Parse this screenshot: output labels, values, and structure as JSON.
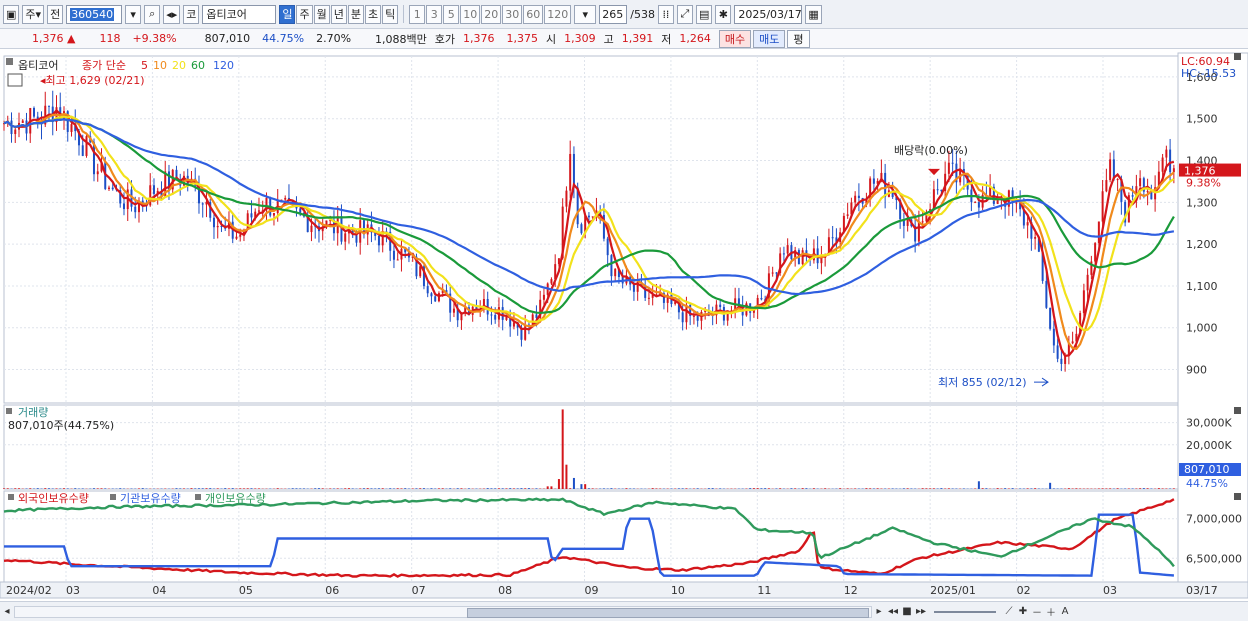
{
  "toolbar": {
    "chart_icon": "chart-icon",
    "stock_type": "주",
    "prev_label": "전",
    "code_value": "360540",
    "name_prefix": "코",
    "stock_name": "옵티코어",
    "periods": [
      "일",
      "주",
      "월",
      "년",
      "분",
      "초",
      "틱"
    ],
    "active_period": "일",
    "intervals": [
      "1",
      "3",
      "5",
      "10",
      "20",
      "30",
      "60",
      "120"
    ],
    "count_value": "265",
    "count_total": "/538",
    "date_value": "2025/03/17"
  },
  "quote": {
    "price": "1,376",
    "arrow": "▲",
    "change": "118",
    "change_pct": "+9.38%",
    "volume": "807,010",
    "vol_ratio": "44.75%",
    "turnover": "2.70%",
    "amount": "1,088백만",
    "ask_label": "호가",
    "ask": "1,376",
    "bid": "1,375",
    "open_label": "시",
    "open": "1,309",
    "high_label": "고",
    "high": "1,391",
    "low_label": "저",
    "low": "1,264",
    "buy_label": "매수",
    "sell_label": "매도",
    "eval_label": "평"
  },
  "colors": {
    "up": "#d4161b",
    "down": "#1c4fc6",
    "ma5": "#d4161b",
    "ma10": "#f08a1c",
    "ma20": "#f2e21b",
    "ma60": "#1a9a3a",
    "ma120": "#2f5fe0",
    "foreign": "#d4161b",
    "institution": "#2f5fe0",
    "individual": "#2f9a5c"
  },
  "chart_data": [
    {
      "type": "candlestick",
      "panel": "price",
      "legend": {
        "name": "옵티코어",
        "ma_label": "종가 단순",
        "ma_periods": [
          "5",
          "10",
          "20",
          "60",
          "120"
        ]
      },
      "x_ticks": [
        "2024/02",
        "03",
        "04",
        "05",
        "06",
        "07",
        "08",
        "09",
        "10",
        "11",
        "12",
        "2025/01",
        "02",
        "03",
        "03/17"
      ],
      "y_ticks": [
        900,
        1000,
        1100,
        1200,
        1300,
        1400,
        1500,
        1600
      ],
      "ylim": [
        820,
        1650
      ],
      "right_labels": {
        "lc": "LC:60.94",
        "hc": "HC:-15.53",
        "last_price": "1,376",
        "last_pct": "9.38%"
      },
      "annotations": {
        "high": "최고 1,629 (02/21)",
        "low": "최저 855 (02/12)",
        "ex_dividend": "배당락(0.00%)"
      },
      "close_path": [
        [
          "2024-02-01",
          1490
        ],
        [
          "2024-02-15",
          1500
        ],
        [
          "2024-02-21",
          1530
        ],
        [
          "2024-03-01",
          1460
        ],
        [
          "2024-03-08",
          1380
        ],
        [
          "2024-03-15",
          1320
        ],
        [
          "2024-03-22",
          1290
        ],
        [
          "2024-04-01",
          1340
        ],
        [
          "2024-04-10",
          1360
        ],
        [
          "2024-04-20",
          1300
        ],
        [
          "2024-04-25",
          1230
        ],
        [
          "2024-05-02",
          1220
        ],
        [
          "2024-05-10",
          1300
        ],
        [
          "2024-05-20",
          1280
        ],
        [
          "2024-06-01",
          1250
        ],
        [
          "2024-06-15",
          1230
        ],
        [
          "2024-06-25",
          1220
        ],
        [
          "2024-07-05",
          1170
        ],
        [
          "2024-07-15",
          1100
        ],
        [
          "2024-07-25",
          1040
        ],
        [
          "2024-08-01",
          1060
        ],
        [
          "2024-08-12",
          1040
        ],
        [
          "2024-08-20",
          990
        ],
        [
          "2024-08-27",
          1050
        ],
        [
          "2024-09-03",
          1200
        ],
        [
          "2024-09-07",
          1450
        ],
        [
          "2024-09-10",
          1250
        ],
        [
          "2024-09-17",
          1280
        ],
        [
          "2024-09-24",
          1120
        ],
        [
          "2024-10-01",
          1090
        ],
        [
          "2024-10-08",
          1070
        ],
        [
          "2024-10-16",
          1050
        ],
        [
          "2024-10-25",
          1020
        ],
        [
          "2024-11-05",
          1040
        ],
        [
          "2024-11-15",
          1050
        ],
        [
          "2024-11-22",
          1090
        ],
        [
          "2024-11-28",
          1200
        ],
        [
          "2024-12-05",
          1160
        ],
        [
          "2024-12-15",
          1180
        ],
        [
          "2024-12-25",
          1310
        ],
        [
          "2025-01-03",
          1350
        ],
        [
          "2025-01-10",
          1330
        ],
        [
          "2025-01-17",
          1220
        ],
        [
          "2025-01-24",
          1300
        ],
        [
          "2025-01-31",
          1370
        ],
        [
          "2025-02-07",
          1340
        ],
        [
          "2025-02-14",
          1300
        ],
        [
          "2025-02-21",
          1320
        ],
        [
          "2025-02-28",
          1270
        ],
        [
          "2025-03-05",
          1230
        ],
        [
          "2025-03-10",
          1060
        ],
        [
          "2025-03-14",
          920
        ],
        [
          "2025-03-21",
          960
        ],
        [
          "2025-03-28",
          1200
        ],
        [
          "2025-04-04",
          1380
        ],
        [
          "2025-04-10",
          1270
        ],
        [
          "2025-04-15",
          1380
        ],
        [
          "2025-04-21",
          1300
        ],
        [
          "2025-04-25",
          1430
        ],
        [
          "2025-04-29",
          1376
        ]
      ],
      "ma_series": [
        {
          "period": "5",
          "smoothing": 3
        },
        {
          "period": "10",
          "smoothing": 6
        },
        {
          "period": "20",
          "smoothing": 11
        },
        {
          "period": "60",
          "smoothing": 28
        },
        {
          "period": "120",
          "smoothing": 50
        }
      ]
    },
    {
      "type": "bar",
      "panel": "volume",
      "title": "거래량",
      "last_label": "807,010주(44.75%)",
      "y_ticks": [
        20000,
        30000
      ],
      "y_tick_labels": [
        "20,000K",
        "30,000K"
      ],
      "ylim": [
        0,
        38000
      ],
      "right_labels": {
        "last_value": "807,010",
        "last_pct": "44.75%"
      },
      "spikes": [
        [
          "2024-08-30",
          1200
        ],
        [
          "2024-09-02",
          4500
        ],
        [
          "2024-09-04",
          36000
        ],
        [
          "2024-09-06",
          11000
        ],
        [
          "2024-09-09",
          5000
        ],
        [
          "2024-09-12",
          2200
        ],
        [
          "2025-02-12",
          3500
        ],
        [
          "2025-03-12",
          2800
        ]
      ]
    },
    {
      "type": "line",
      "panel": "holdings",
      "legend": [
        "외국인보유수량",
        "기관보유수량",
        "개인보유수량"
      ],
      "y_ticks": [
        6500000,
        7000000
      ],
      "y_tick_labels": [
        "6,500,000",
        "7,000,000"
      ],
      "ylim": [
        6200000,
        7350000
      ],
      "series": [
        {
          "name": "외국인보유수량",
          "anchors": [
            [
              "2024-02-01",
              6480000
            ],
            [
              "2024-03-01",
              6420000
            ],
            [
              "2024-05-01",
              6320000
            ],
            [
              "2024-06-15",
              6280000
            ],
            [
              "2024-08-15",
              6290000
            ],
            [
              "2024-09-04",
              6520000
            ],
            [
              "2024-09-30",
              6380000
            ],
            [
              "2024-10-20",
              6350000
            ],
            [
              "2024-11-15",
              6440000
            ],
            [
              "2024-12-05",
              6600000
            ],
            [
              "2024-12-10",
              6880000
            ],
            [
              "2024-12-12",
              6380000
            ],
            [
              "2025-01-05",
              6300000
            ],
            [
              "2025-01-20",
              6500000
            ],
            [
              "2025-02-20",
              6700000
            ],
            [
              "2025-03-20",
              6620000
            ],
            [
              "2025-04-05",
              6980000
            ],
            [
              "2025-04-20",
              7150000
            ],
            [
              "2025-04-29",
              7250000
            ]
          ]
        },
        {
          "name": "기관보유수량",
          "anchors": [
            [
              "2024-02-01",
              6650000
            ],
            [
              "2024-02-25",
              6650000
            ],
            [
              "2024-02-26",
              6400000
            ],
            [
              "2024-05-15",
              6400000
            ],
            [
              "2024-05-16",
              6750000
            ],
            [
              "2024-08-30",
              6750000
            ],
            [
              "2024-08-31",
              6420000
            ],
            [
              "2024-09-04",
              6620000
            ],
            [
              "2024-09-28",
              6620000
            ],
            [
              "2024-09-29",
              7000000
            ],
            [
              "2024-10-08",
              7000000
            ],
            [
              "2024-10-12",
              6280000
            ],
            [
              "2024-11-18",
              6280000
            ],
            [
              "2024-11-21",
              6450000
            ],
            [
              "2024-12-20",
              6400000
            ],
            [
              "2024-12-22",
              6300000
            ],
            [
              "2025-03-28",
              6280000
            ],
            [
              "2025-03-30",
              7050000
            ],
            [
              "2025-04-13",
              7050000
            ],
            [
              "2025-04-15",
              6320000
            ],
            [
              "2025-04-29",
              6280000
            ]
          ]
        },
        {
          "name": "개인보유수량",
          "anchors": [
            [
              "2024-02-01",
              7100000
            ],
            [
              "2024-03-15",
              7150000
            ],
            [
              "2024-05-15",
              7180000
            ],
            [
              "2024-07-15",
              7230000
            ],
            [
              "2024-09-04",
              7240000
            ],
            [
              "2024-09-20",
              7060000
            ],
            [
              "2024-10-10",
              7210000
            ],
            [
              "2024-11-10",
              7120000
            ],
            [
              "2024-11-18",
              6860000
            ],
            [
              "2024-12-10",
              6820000
            ],
            [
              "2024-12-12",
              6500000
            ],
            [
              "2025-01-10",
              6880000
            ],
            [
              "2025-01-25",
              6700000
            ],
            [
              "2025-02-20",
              6520000
            ],
            [
              "2025-03-10",
              6760000
            ],
            [
              "2025-03-28",
              7000000
            ],
            [
              "2025-04-12",
              6900000
            ],
            [
              "2025-04-20",
              6680000
            ],
            [
              "2025-04-29",
              6380000
            ]
          ]
        }
      ]
    }
  ]
}
